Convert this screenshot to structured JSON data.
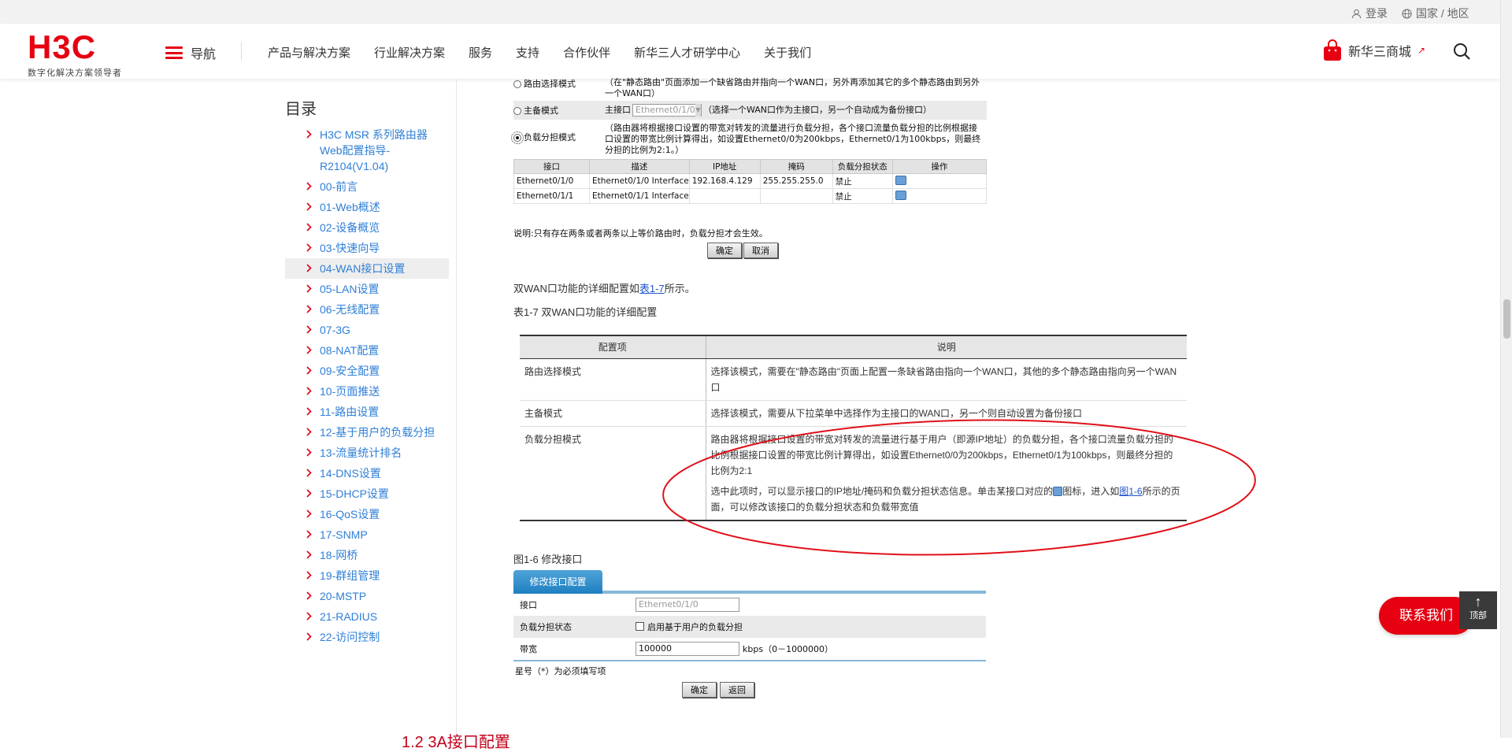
{
  "topbar": {
    "login": "登录",
    "region": "国家 / 地区"
  },
  "header": {
    "logo_mark": "H3C",
    "logo_sub": "数字化解决方案领导者",
    "nav_label": "导航",
    "nav_links": [
      "产品与解决方案",
      "行业解决方案",
      "服务",
      "支持",
      "合作伙伴",
      "新华三人才研学中心",
      "关于我们"
    ],
    "store": "新华三商城"
  },
  "sidebar": {
    "title": "目录",
    "items": [
      "H3C MSR 系列路由器 Web配置指导-R2104(V1.04)",
      "00-前言",
      "01-Web概述",
      "02-设备概览",
      "03-快速向导",
      "04-WAN接口设置",
      "05-LAN设置",
      "06-无线配置",
      "07-3G",
      "08-NAT配置",
      "09-安全配置",
      "10-页面推送",
      "11-路由设置",
      "12-基于用户的负载分担",
      "13-流量统计排名",
      "14-DNS设置",
      "15-DHCP设置",
      "16-QoS设置",
      "17-SNMP",
      "18-网桥",
      "19-群组管理",
      "20-MSTP",
      "21-RADIUS",
      "22-访问控制"
    ],
    "active_index": 5
  },
  "shot": {
    "route_mode": "路由选择模式",
    "route_desc": "（在\"静态路由\"页面添加一个缺省路由并指向一个WAN口，另外再添加其它的多个静态路由到另外一个WAN口）",
    "backup_mode": "主备模式",
    "backup_main": "主接口",
    "backup_select": "Ethernet0/1/0",
    "backup_desc": "（选择一个WAN口作为主接口，另一个自动成为备份接口）",
    "lb_mode": "负载分担模式",
    "lb_desc": "（路由器将根据接口设置的带宽对转发的流量进行负载分担，各个接口流量负载分担的比例根据接口设置的带宽比例计算得出，如设置Ethernet0/0为200kbps，Ethernet0/1为100kbps，则最终分担的比例为2:1。）",
    "table_headers": [
      "接口",
      "描述",
      "IP地址",
      "掩码",
      "负载分担状态",
      "操作"
    ],
    "table_rows": [
      [
        "Ethernet0/1/0",
        "Ethernet0/1/0 Interface",
        "192.168.4.129",
        "255.255.255.0",
        "禁止"
      ],
      [
        "Ethernet0/1/1",
        "Ethernet0/1/1 Interface",
        "",
        "",
        "禁止"
      ]
    ],
    "note": "说明:只有存在两条或者两条以上等价路由时，负载分担才会生效。",
    "ok": "确定",
    "cancel": "取消"
  },
  "para": {
    "intro_pre": "双WAN口功能的详细配置如",
    "intro_link": "表1-7",
    "intro_post": "所示。",
    "caption": "表1-7 双WAN口功能的详细配置"
  },
  "cfg": {
    "h1": "配置项",
    "h2": "说明",
    "r1k": "路由选择模式",
    "r1v": "选择该模式，需要在\"静态路由\"页面上配置一条缺省路由指向一个WAN口，其他的多个静态路由指向另一个WAN口",
    "r2k": "主备模式",
    "r2v": "选择该模式，需要从下拉菜单中选择作为主接口的WAN口，另一个则自动设置为备份接口",
    "r3k": "负载分担模式",
    "r3v1": "路由器将根据接口设置的带宽对转发的流量进行基于用户（即源IP地址）的负载分担，各个接口流量负载分担的比例根据接口设置的带宽比例计算得出，如设置Ethernet0/0为200kbps，Ethernet0/1为100kbps，则最终分担的比例为2:1",
    "r3v2_pre": "选中此项时，可以显示接口的IP地址/掩码和负载分担状态信息。单击某接口对应的",
    "r3v2_mid": "图标，进入如",
    "r3v2_link": "图1-6",
    "r3v2_post": "所示的页面，可以修改该接口的负载分担状态和负载带宽值"
  },
  "mod": {
    "caption": "图1-6 修改接口",
    "tab": "修改接口配置",
    "if_label": "接口",
    "if_value": "Ethernet0/1/0",
    "lb_label": "负载分担状态",
    "lb_check": "启用基于用户的负载分担",
    "bw_label": "带宽",
    "bw_value": "100000",
    "bw_unit": "kbps（0－1000000）",
    "required": "星号（*）为必须填写项",
    "ok": "确定",
    "back": "返回"
  },
  "section_peek": "1.2  3A接口配置",
  "float": {
    "contact": "联系我们",
    "top": "顶部"
  },
  "colors": {
    "brand": "#e60012",
    "link": "#2f7fd6",
    "oval": "#e0101a"
  }
}
